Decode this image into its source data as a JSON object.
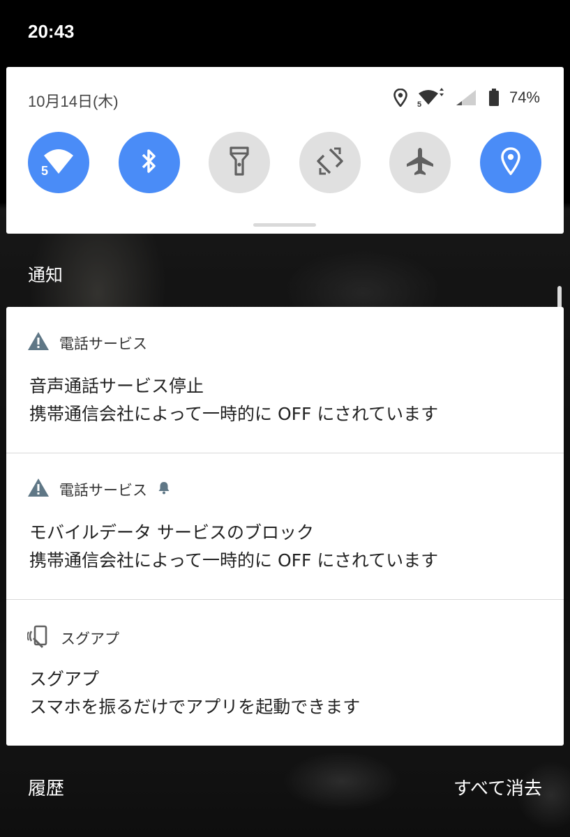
{
  "status_bar": {
    "time": "20:43"
  },
  "quick_settings": {
    "date": "10月14日(木)",
    "battery_percent": "74%",
    "wifi_badge": "5",
    "accent_color": "#4a8cf7",
    "tiles": [
      {
        "icon": "wifi-icon",
        "state": "on"
      },
      {
        "icon": "bluetooth-icon",
        "state": "on"
      },
      {
        "icon": "flashlight-icon",
        "state": "off"
      },
      {
        "icon": "auto-rotate-icon",
        "state": "off"
      },
      {
        "icon": "airplane-icon",
        "state": "off"
      },
      {
        "icon": "location-icon",
        "state": "on"
      }
    ]
  },
  "notifications_section": {
    "title": "通知"
  },
  "notifications": [
    {
      "app": "電話サービス",
      "app_icon": "warning-icon",
      "title": "音声通話サービス停止",
      "text": "携帯通信会社によって一時的に OFF にされています"
    },
    {
      "app": "電話サービス",
      "app_icon": "warning-icon",
      "extra_icon": "bell-icon",
      "title": "モバイルデータ サービスのブロック",
      "text": "携帯通信会社によって一時的に OFF にされています"
    },
    {
      "app": "スグアプ",
      "app_icon": "shake-phone-icon",
      "title": "スグアプ",
      "text": "スマホを振るだけでアプリを起動できます"
    }
  ],
  "footer": {
    "history_label": "履歴",
    "clear_all_label": "すべて消去"
  }
}
